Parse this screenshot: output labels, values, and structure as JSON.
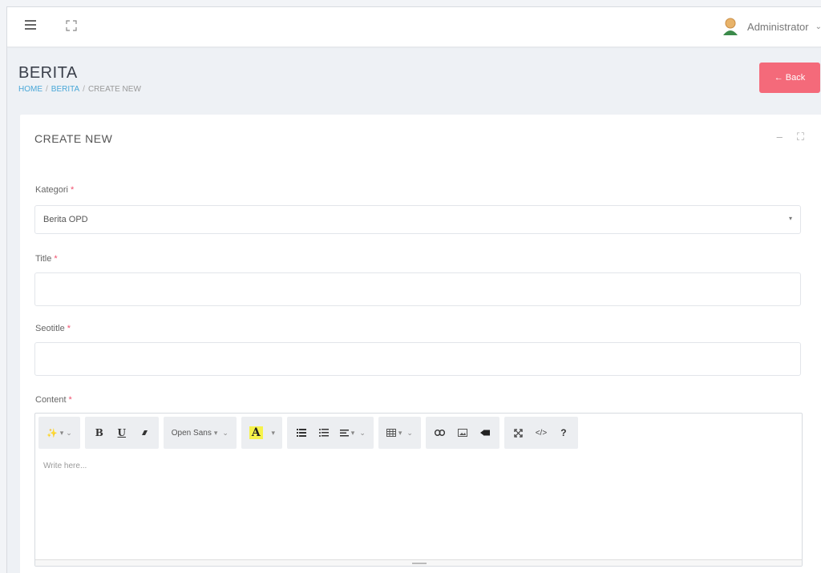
{
  "user": {
    "name": "Administrator",
    "caret": "⌄"
  },
  "page": {
    "title": "BERITA"
  },
  "breadcrumb": {
    "home": "HOME",
    "section": "BERITA",
    "current": "CREATE NEW",
    "sep": "/"
  },
  "back_button": {
    "label": "← Back"
  },
  "card": {
    "title": "CREATE NEW",
    "minimize": "–",
    "fullscreen": "⛶"
  },
  "form": {
    "kategori": {
      "label": "Kategori",
      "required": "*",
      "value": "Berita OPD",
      "caret": "▾"
    },
    "title": {
      "label": "Title",
      "required": "*",
      "value": ""
    },
    "seotitle": {
      "label": "Seotitle",
      "required": "*",
      "value": ""
    },
    "content": {
      "label": "Content",
      "required": "*",
      "placeholder": "Write here..."
    }
  },
  "toolbar": {
    "magic": "✨",
    "bold": "B",
    "underline": "U",
    "eraser": "⬛",
    "font": "Open Sans",
    "color_letter": "A",
    "ul_list": "☰",
    "ol_list": "☲",
    "align": "≡",
    "table": "▦",
    "link": "∞",
    "image": "▣",
    "video": "▶",
    "fullscreen": "⤢",
    "code": "</>",
    "help": "?"
  },
  "colors": {
    "accent": "#f46a7a",
    "link": "#4aa8d8",
    "required": "#f0506e"
  }
}
